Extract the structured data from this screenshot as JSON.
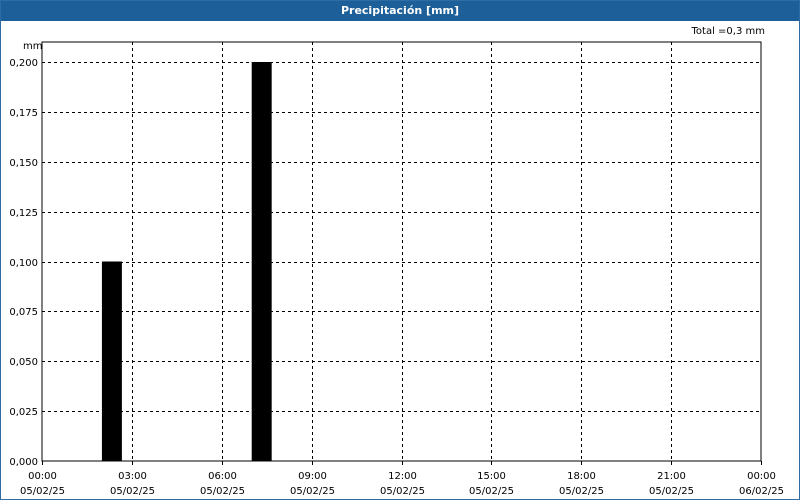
{
  "window": {
    "title": "Precipitación [mm]"
  },
  "total_label": "Total =0,3 mm",
  "unit_label": "mm",
  "chart_data": {
    "type": "bar",
    "title": "Precipitación [mm]",
    "ylabel": "mm",
    "xlabel": "",
    "ylim": [
      0,
      0.2
    ],
    "yticks": [
      "0,000",
      "0,025",
      "0,050",
      "0,075",
      "0,100",
      "0,125",
      "0,150",
      "0,175",
      "0,200"
    ],
    "xlim_hours": [
      0,
      24
    ],
    "xticks": [
      {
        "time": "00:00",
        "date": "05/02/25"
      },
      {
        "time": "03:00",
        "date": "05/02/25"
      },
      {
        "time": "06:00",
        "date": "05/02/25"
      },
      {
        "time": "09:00",
        "date": "05/02/25"
      },
      {
        "time": "12:00",
        "date": "05/02/25"
      },
      {
        "time": "15:00",
        "date": "05/02/25"
      },
      {
        "time": "18:00",
        "date": "05/02/25"
      },
      {
        "time": "21:00",
        "date": "05/02/25"
      },
      {
        "time": "00:00",
        "date": "06/02/25"
      }
    ],
    "bars": [
      {
        "start": "05/02/25 02:00",
        "end": "05/02/25 02:40",
        "value": 0.1
      },
      {
        "start": "05/02/25 07:00",
        "end": "05/02/25 07:40",
        "value": 0.2
      }
    ],
    "bar_color": "#000000",
    "grid": true
  }
}
